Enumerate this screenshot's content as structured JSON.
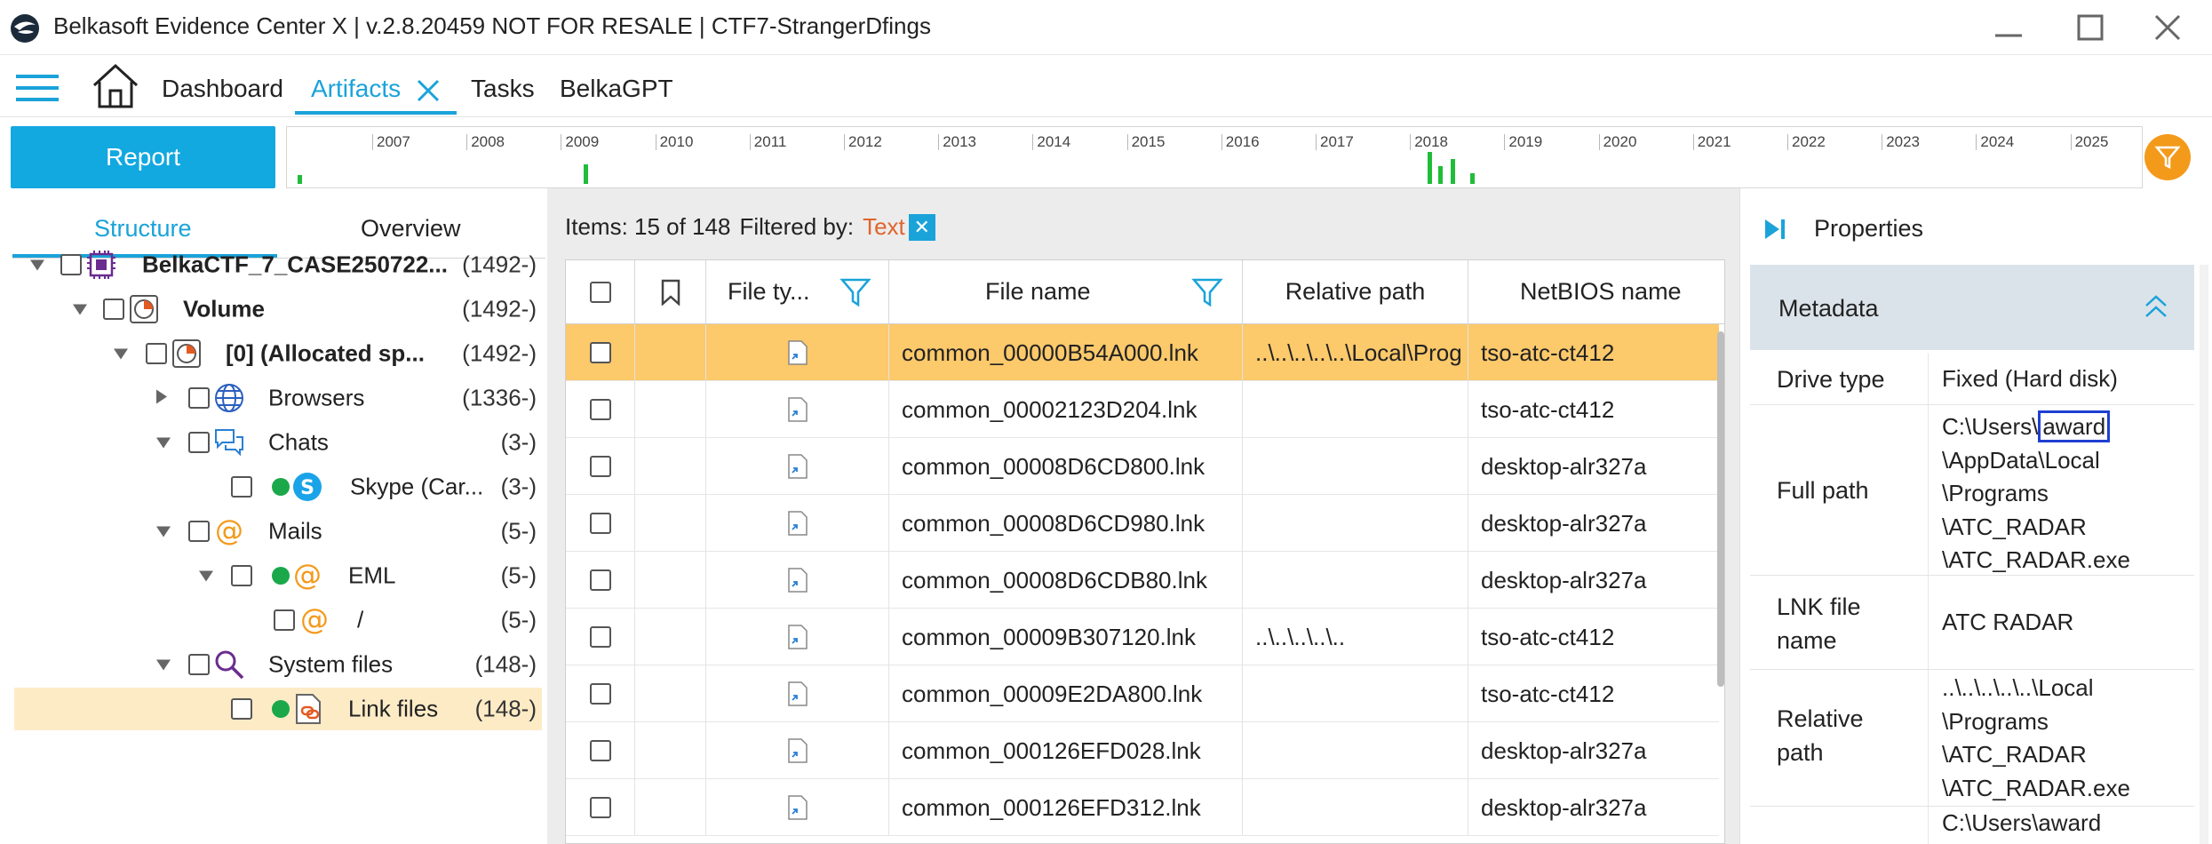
{
  "window": {
    "title": "Belkasoft Evidence Center X | v.2.8.20459 NOT FOR RESALE | CTF7-StrangerDfings"
  },
  "nav": {
    "dashboard": "Dashboard",
    "artifacts": "Artifacts",
    "tasks": "Tasks",
    "belkagpt": "BelkaGPT"
  },
  "toolbar": {
    "report_label": "Report"
  },
  "timeline": {
    "years": [
      "2007",
      "2008",
      "2009",
      "2010",
      "2011",
      "2012",
      "2013",
      "2014",
      "2015",
      "2016",
      "2017",
      "2018",
      "2019",
      "2020",
      "2021",
      "2022",
      "2023",
      "2024",
      "2025"
    ],
    "activity_color": "#1fbd3a"
  },
  "left_panel": {
    "tabs": [
      "Structure",
      "Overview"
    ],
    "active_tab": "Structure",
    "tree": [
      {
        "label": "BelkaCTF_7_CASE250722...",
        "count": "(1492-)",
        "bold": true
      },
      {
        "label": "Volume",
        "count": "(1492-)",
        "bold": true
      },
      {
        "label": "[0] (Allocated sp...",
        "count": "(1492-)",
        "bold": true
      },
      {
        "label": "Browsers",
        "count": "(1336-)",
        "bold": false
      },
      {
        "label": "Chats",
        "count": "(3-)",
        "bold": false
      },
      {
        "label": "Skype (Car...",
        "count": "(3-)",
        "bold": false
      },
      {
        "label": "Mails",
        "count": "(5-)",
        "bold": false
      },
      {
        "label": "EML",
        "count": "(5-)",
        "bold": false
      },
      {
        "label": "/",
        "count": "(5-)",
        "bold": false
      },
      {
        "label": "System files",
        "count": "(148-)",
        "bold": false
      },
      {
        "label": "Link files",
        "count": "(148-)",
        "bold": false
      }
    ]
  },
  "grid": {
    "items_label": "Items: 15 of 148",
    "filtered_by_label": "Filtered by:",
    "filtered_value": "Text",
    "columns": {
      "file_type": "File ty...",
      "file_name": "File name",
      "relative_path": "Relative path",
      "netbios_name": "NetBIOS name"
    },
    "rows": [
      {
        "file_name": "common_00000B54A000.lnk",
        "relative_path": "..\\..\\..\\..\\..\\Local\\Prog",
        "netbios": "tso-atc-ct412"
      },
      {
        "file_name": "common_00002123D204.lnk",
        "relative_path": "",
        "netbios": "tso-atc-ct412"
      },
      {
        "file_name": "common_00008D6CD800.lnk",
        "relative_path": "",
        "netbios": "desktop-alr327a"
      },
      {
        "file_name": "common_00008D6CD980.lnk",
        "relative_path": "",
        "netbios": "desktop-alr327a"
      },
      {
        "file_name": "common_00008D6CDB80.lnk",
        "relative_path": "",
        "netbios": "desktop-alr327a"
      },
      {
        "file_name": "common_00009B307120.lnk",
        "relative_path": "..\\..\\..\\..\\..",
        "netbios": "tso-atc-ct412"
      },
      {
        "file_name": "common_00009E2DA800.lnk",
        "relative_path": "",
        "netbios": "tso-atc-ct412"
      },
      {
        "file_name": "common_000126EFD028.lnk",
        "relative_path": "",
        "netbios": "desktop-alr327a"
      },
      {
        "file_name": "common_000126EFD312.lnk",
        "relative_path": "",
        "netbios": "desktop-alr327a"
      }
    ]
  },
  "properties": {
    "title": "Properties",
    "section": "Metadata",
    "drive_type_key": "Drive type",
    "drive_type_val": "Fixed (Hard disk)",
    "full_path_key": "Full path",
    "full_path_prefix": "C:\\Users\\",
    "full_path_highlight": "award",
    "full_path_rest": [
      "\\AppData\\Local",
      "\\Programs",
      "\\ATC_RADAR",
      "\\ATC_RADAR.exe"
    ],
    "lnk_key_1": "LNK file",
    "lnk_key_2": "name",
    "lnk_val": "ATC RADAR",
    "rel_key_1": "Relative",
    "rel_key_2": "path",
    "rel_val": [
      "..\\..\\..\\..\\..\\Local",
      "\\Programs",
      "\\ATC_RADAR",
      "\\ATC_RADAR.exe"
    ],
    "next_val": "C:\\Users\\award"
  },
  "colors": {
    "accent": "#1aa3d9",
    "report_button": "#12a8e0",
    "selected_row": "#fcc96b",
    "filter_circle": "#f39a1b",
    "filtered_text": "#e0642c",
    "highlight_box": "#1f3fd1"
  }
}
